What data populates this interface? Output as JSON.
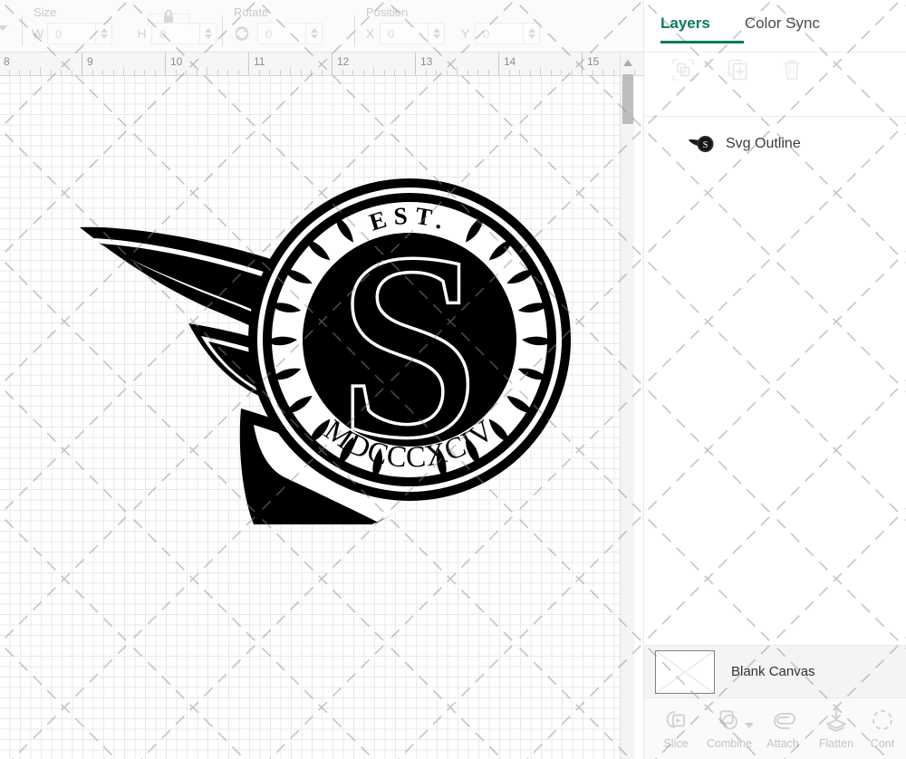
{
  "toolbar": {
    "size": {
      "label": "Size",
      "width_label": "W",
      "width_value": "0",
      "height_label": "H",
      "height_value": "0",
      "lock_icon": "lock-closed-icon"
    },
    "rotate": {
      "label": "Rotate",
      "value": "0",
      "icon": "rotate-icon"
    },
    "position": {
      "label": "Position",
      "x_label": "X",
      "x_value": "0",
      "y_label": "Y",
      "y_value": "0"
    },
    "left_caret_icon": "chevron-down-icon"
  },
  "ruler": {
    "unit_marks": [
      "8",
      "9",
      "10",
      "11",
      "12",
      "13",
      "14",
      "15"
    ]
  },
  "canvas": {
    "artwork_name": "svg-outline-logo",
    "artwork_text": {
      "top": "EST.",
      "monogram": "S",
      "bottom": "MDCCCXCIV"
    },
    "scrollbar": {
      "up_arrow_icon": "caret-up-icon"
    }
  },
  "panel": {
    "tabs": [
      {
        "label": "Layers",
        "active": true
      },
      {
        "label": "Color Sync",
        "active": false
      }
    ],
    "accent_color": "#0a7a5e",
    "actions": [
      {
        "name": "group-icon",
        "label": "Group"
      },
      {
        "name": "duplicate-icon",
        "label": "Duplicate"
      },
      {
        "name": "delete-icon",
        "label": "Delete"
      }
    ],
    "layers": [
      {
        "name": "Svg Outline",
        "thumb": "svg-outline-thumb"
      }
    ],
    "canvas_row": {
      "label": "Blank Canvas",
      "thumb": "blank-canvas-thumb"
    },
    "action_bar": [
      {
        "label": "Slice",
        "icon": "slice-icon",
        "has_caret": false
      },
      {
        "label": "Combine",
        "icon": "combine-icon",
        "has_caret": true
      },
      {
        "label": "Attach",
        "icon": "attach-icon",
        "has_caret": false
      },
      {
        "label": "Flatten",
        "icon": "flatten-icon",
        "has_caret": false
      },
      {
        "label": "Cont",
        "icon": "contour-icon",
        "has_caret": false
      }
    ]
  }
}
